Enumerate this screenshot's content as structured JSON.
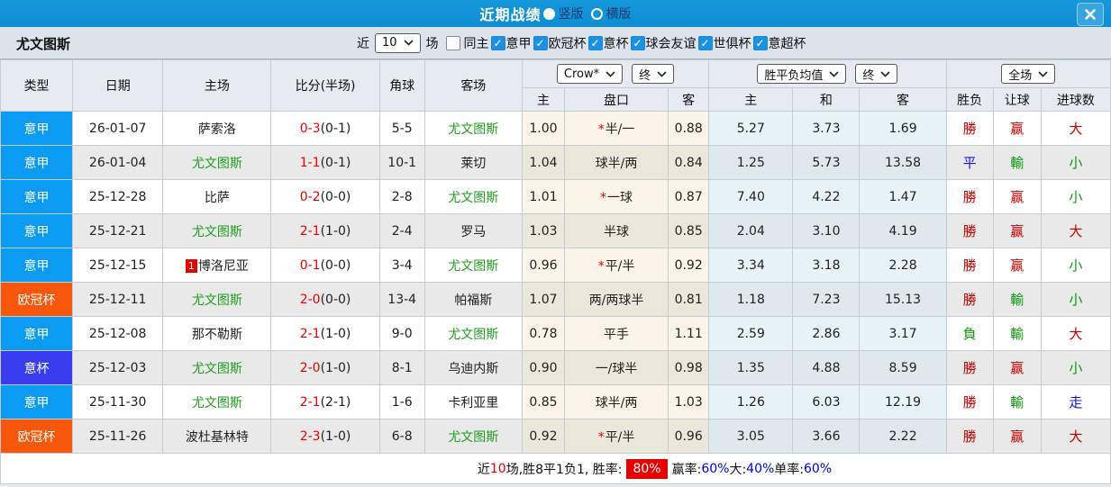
{
  "titlebar": {
    "title": "近期战绩",
    "radio_vertical": "竖版",
    "radio_horizontal": "横版"
  },
  "filterbar": {
    "team": "尤文图斯",
    "near_label": "近",
    "matches_count": "10",
    "matches_label": "场",
    "checkboxes": [
      {
        "label": "同主",
        "checked": false
      },
      {
        "label": "意甲",
        "checked": true
      },
      {
        "label": "欧冠杯",
        "checked": true
      },
      {
        "label": "意杯",
        "checked": true
      },
      {
        "label": "球会友谊",
        "checked": true
      },
      {
        "label": "世俱杯",
        "checked": true
      },
      {
        "label": "意超杯",
        "checked": true
      }
    ]
  },
  "colors": {
    "header_blue": "#1193d6",
    "win_red": "#c80000",
    "lose_green": "#0a9a0a",
    "draw_blue": "#1515dd",
    "score_red": "#ee0000",
    "team_green": "#1f9c1f",
    "summary_box_red": "#e80000",
    "summary_value_blue": "#0000e6"
  },
  "league_colors": {
    "意甲": "#0b9bf2",
    "欧冠杯": "#f7570b",
    "意杯": "#3a3cf0"
  },
  "table": {
    "col_headers": {
      "type": "类型",
      "date": "日期",
      "home": "主场",
      "score": "比分(半场)",
      "corner": "角球",
      "away": "客场"
    },
    "selects": {
      "odds_company": "Crow*",
      "odds_time": "终",
      "avg": "胜平负均值",
      "avg_time": "终",
      "scope": "全场"
    },
    "sub_headers": {
      "odds_home": "主",
      "odds_handicap": "盘口",
      "odds_away": "客",
      "avg_home": "主",
      "avg_draw": "和",
      "avg_away": "客",
      "res_wdl": "胜负",
      "res_let": "让球",
      "res_goal": "进球数"
    },
    "rows": [
      {
        "type": "意甲",
        "date": "26-01-07",
        "home": "萨索洛",
        "home_green": false,
        "home_rank": "",
        "score": "0-3",
        "half": "(0-1)",
        "corner": "5-5",
        "away": "尤文图斯",
        "away_green": true,
        "odds_home": "1.00",
        "handicap": "半/一",
        "handicap_star": true,
        "odds_away": "0.88",
        "avg_home": "5.27",
        "avg_draw": "3.73",
        "avg_away": "1.69",
        "res_wdl": "勝",
        "res_wdl_c": "red",
        "res_let": "赢",
        "res_let_c": "red",
        "res_goal": "大",
        "res_goal_c": "red"
      },
      {
        "type": "意甲",
        "date": "26-01-04",
        "home": "尤文图斯",
        "home_green": true,
        "home_rank": "",
        "score": "1-1",
        "half": "(0-1)",
        "corner": "10-1",
        "away": "莱切",
        "away_green": false,
        "odds_home": "1.04",
        "handicap": "球半/两",
        "handicap_star": false,
        "odds_away": "0.84",
        "avg_home": "1.25",
        "avg_draw": "5.73",
        "avg_away": "13.58",
        "res_wdl": "平",
        "res_wdl_c": "blue",
        "res_let": "輸",
        "res_let_c": "green",
        "res_goal": "小",
        "res_goal_c": "green"
      },
      {
        "type": "意甲",
        "date": "25-12-28",
        "home": "比萨",
        "home_green": false,
        "home_rank": "",
        "score": "0-2",
        "half": "(0-0)",
        "corner": "2-8",
        "away": "尤文图斯",
        "away_green": true,
        "odds_home": "1.01",
        "handicap": "一球",
        "handicap_star": true,
        "odds_away": "0.87",
        "avg_home": "7.40",
        "avg_draw": "4.22",
        "avg_away": "1.47",
        "res_wdl": "勝",
        "res_wdl_c": "red",
        "res_let": "赢",
        "res_let_c": "red",
        "res_goal": "小",
        "res_goal_c": "green"
      },
      {
        "type": "意甲",
        "date": "25-12-21",
        "home": "尤文图斯",
        "home_green": true,
        "home_rank": "",
        "score": "2-1",
        "half": "(1-0)",
        "corner": "2-4",
        "away": "罗马",
        "away_green": false,
        "odds_home": "1.03",
        "handicap": "半球",
        "handicap_star": false,
        "odds_away": "0.85",
        "avg_home": "2.04",
        "avg_draw": "3.10",
        "avg_away": "4.19",
        "res_wdl": "勝",
        "res_wdl_c": "red",
        "res_let": "赢",
        "res_let_c": "red",
        "res_goal": "大",
        "res_goal_c": "red"
      },
      {
        "type": "意甲",
        "date": "25-12-15",
        "home": "博洛尼亚",
        "home_green": false,
        "home_rank": "1",
        "score": "0-1",
        "half": "(0-0)",
        "corner": "3-4",
        "away": "尤文图斯",
        "away_green": true,
        "odds_home": "0.96",
        "handicap": "平/半",
        "handicap_star": true,
        "odds_away": "0.92",
        "avg_home": "3.34",
        "avg_draw": "3.18",
        "avg_away": "2.28",
        "res_wdl": "勝",
        "res_wdl_c": "red",
        "res_let": "赢",
        "res_let_c": "red",
        "res_goal": "小",
        "res_goal_c": "green"
      },
      {
        "type": "欧冠杯",
        "date": "25-12-11",
        "home": "尤文图斯",
        "home_green": true,
        "home_rank": "",
        "score": "2-0",
        "half": "(0-0)",
        "corner": "13-4",
        "away": "帕福斯",
        "away_green": false,
        "odds_home": "1.07",
        "handicap": "两/两球半",
        "handicap_star": false,
        "odds_away": "0.81",
        "avg_home": "1.18",
        "avg_draw": "7.23",
        "avg_away": "15.13",
        "res_wdl": "勝",
        "res_wdl_c": "red",
        "res_let": "輸",
        "res_let_c": "green",
        "res_goal": "小",
        "res_goal_c": "green"
      },
      {
        "type": "意甲",
        "date": "25-12-08",
        "home": "那不勒斯",
        "home_green": false,
        "home_rank": "",
        "score": "2-1",
        "half": "(1-0)",
        "corner": "9-0",
        "away": "尤文图斯",
        "away_green": true,
        "odds_home": "0.78",
        "handicap": "平手",
        "handicap_star": false,
        "odds_away": "1.11",
        "avg_home": "2.59",
        "avg_draw": "2.86",
        "avg_away": "3.17",
        "res_wdl": "負",
        "res_wdl_c": "green",
        "res_let": "輸",
        "res_let_c": "green",
        "res_goal": "大",
        "res_goal_c": "red"
      },
      {
        "type": "意杯",
        "date": "25-12-03",
        "home": "尤文图斯",
        "home_green": true,
        "home_rank": "",
        "score": "2-0",
        "half": "(1-0)",
        "corner": "8-1",
        "away": "乌迪内斯",
        "away_green": false,
        "odds_home": "0.90",
        "handicap": "一/球半",
        "handicap_star": false,
        "odds_away": "0.98",
        "avg_home": "1.35",
        "avg_draw": "4.88",
        "avg_away": "8.59",
        "res_wdl": "勝",
        "res_wdl_c": "red",
        "res_let": "赢",
        "res_let_c": "red",
        "res_goal": "小",
        "res_goal_c": "green"
      },
      {
        "type": "意甲",
        "date": "25-11-30",
        "home": "尤文图斯",
        "home_green": true,
        "home_rank": "",
        "score": "2-1",
        "half": "(2-1)",
        "corner": "1-6",
        "away": "卡利亚里",
        "away_green": false,
        "odds_home": "0.85",
        "handicap": "球半/两",
        "handicap_star": false,
        "odds_away": "1.03",
        "avg_home": "1.26",
        "avg_draw": "6.03",
        "avg_away": "12.19",
        "res_wdl": "勝",
        "res_wdl_c": "red",
        "res_let": "輸",
        "res_let_c": "green",
        "res_goal": "走",
        "res_goal_c": "blue"
      },
      {
        "type": "欧冠杯",
        "date": "25-11-26",
        "home": "波杜基林特",
        "home_green": false,
        "home_rank": "",
        "score": "2-3",
        "half": "(1-0)",
        "corner": "6-8",
        "away": "尤文图斯",
        "away_green": true,
        "odds_home": "0.92",
        "handicap": "平/半",
        "handicap_star": true,
        "odds_away": "0.96",
        "avg_home": "3.05",
        "avg_draw": "3.66",
        "avg_away": "2.22",
        "res_wdl": "勝",
        "res_wdl_c": "red",
        "res_let": "赢",
        "res_let_c": "red",
        "res_goal": "大",
        "res_goal_c": "red"
      }
    ]
  },
  "summary": {
    "segments": [
      {
        "text": "近",
        "style": "plain"
      },
      {
        "text": "10",
        "style": "red"
      },
      {
        "text": "场,胜8平1负1, 胜率:",
        "style": "plain"
      },
      {
        "text": "80%",
        "style": "redbox"
      },
      {
        "text": " 赢率:",
        "style": "plain"
      },
      {
        "text": "60%",
        "style": "blue"
      },
      {
        "text": " 大:",
        "style": "plain"
      },
      {
        "text": "40%",
        "style": "blue"
      },
      {
        "text": " 单率:",
        "style": "plain"
      },
      {
        "text": "60%",
        "style": "blue"
      }
    ]
  }
}
